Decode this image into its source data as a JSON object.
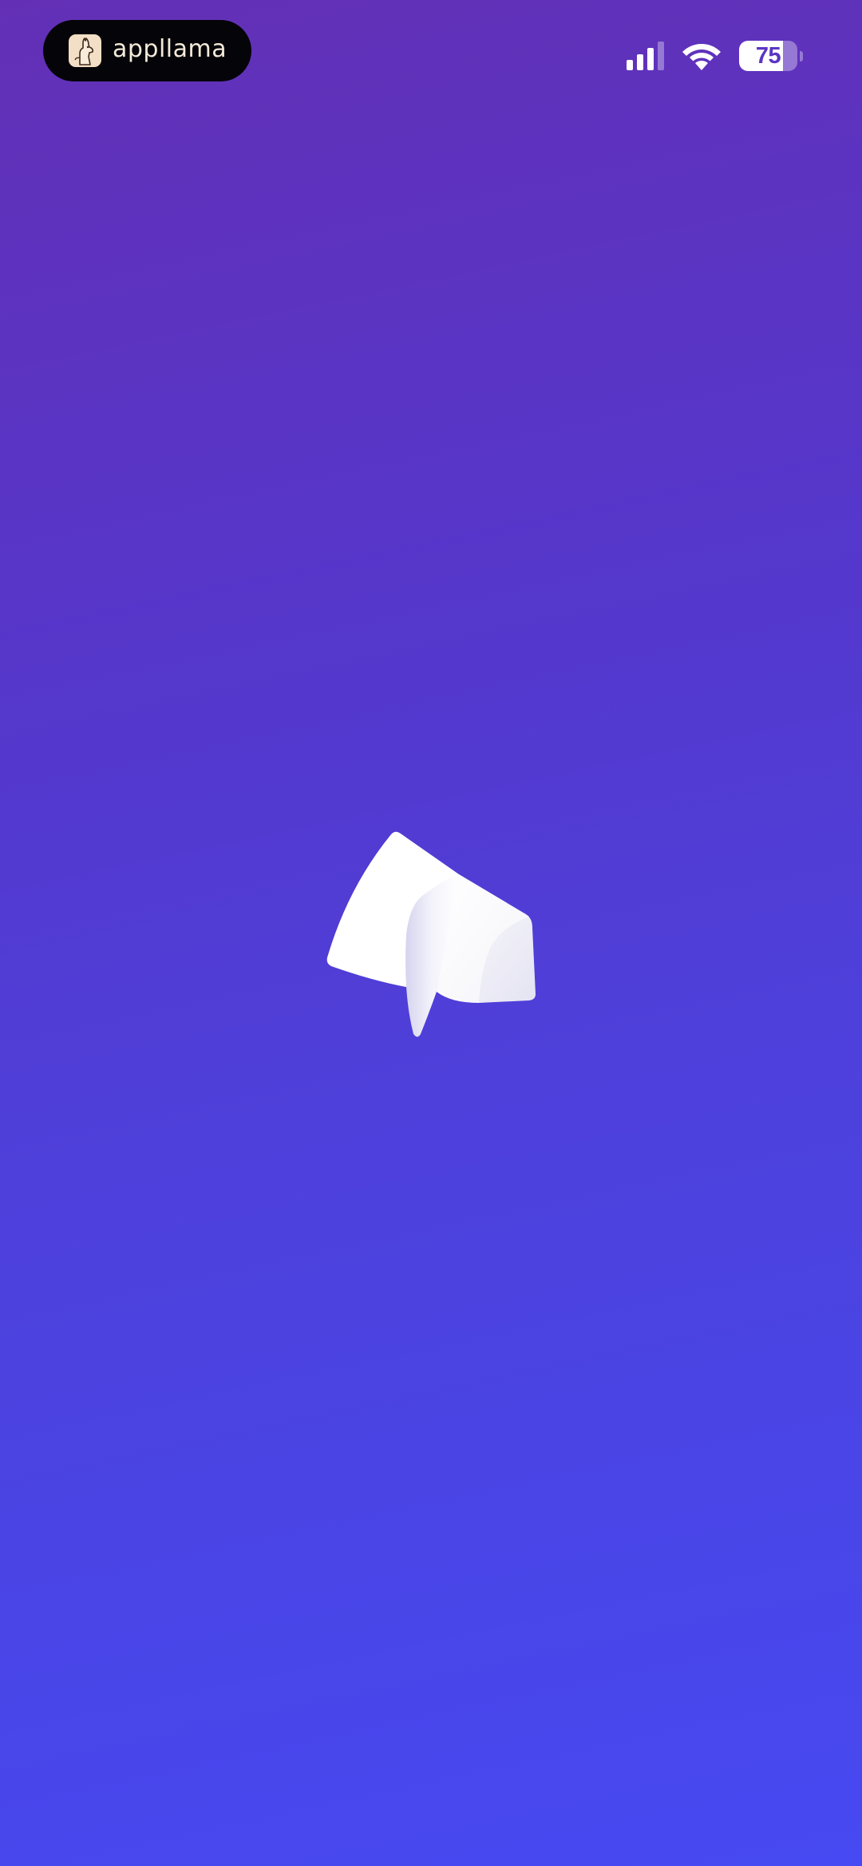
{
  "status_bar": {
    "app_name": "appllama",
    "app_icon": "llama-icon",
    "signal_icon": "cellular-signal-icon",
    "signal_bars_active": 3,
    "signal_bars_total": 4,
    "wifi_icon": "wifi-icon",
    "battery_icon": "battery-icon",
    "battery_percent": "75",
    "battery_level": 0.75
  },
  "splash": {
    "logo_icon": "app-logo-icon"
  },
  "colors": {
    "background_top": "#6330b5",
    "background_bottom": "#4749f2",
    "pill_background": "#050408",
    "logo": "#ffffff"
  }
}
